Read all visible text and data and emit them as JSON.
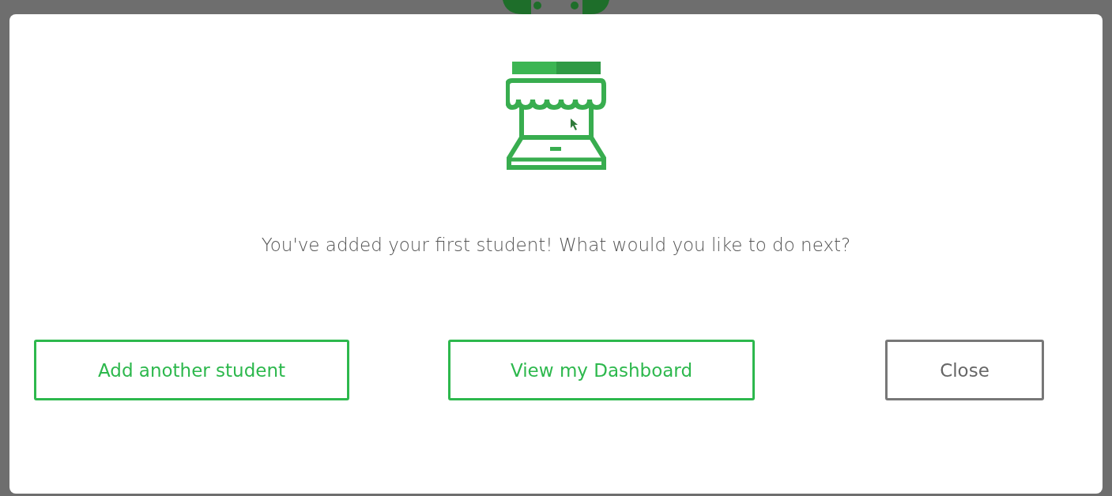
{
  "dialog": {
    "message": "You've added your first student! What would you like to do next?",
    "buttons": [
      {
        "label": "Add another student",
        "kind": "primary"
      },
      {
        "label": "View my Dashboard",
        "kind": "primary"
      },
      {
        "label": "Close",
        "kind": "secondary"
      }
    ]
  }
}
